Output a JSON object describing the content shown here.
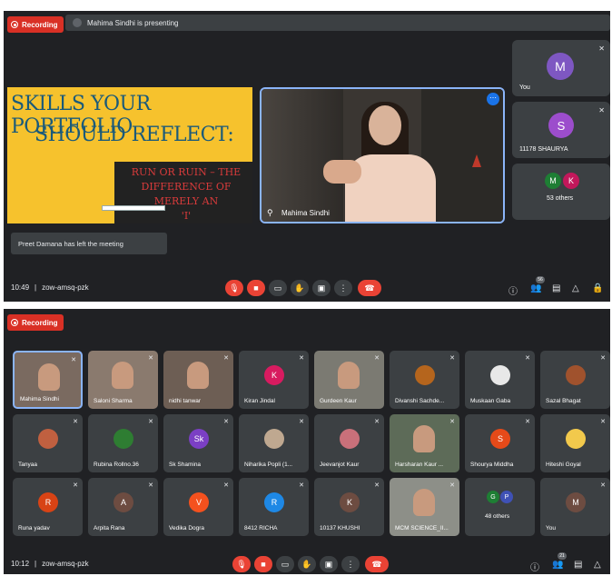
{
  "panel1": {
    "recording_label": "Recording",
    "presenting_text": "Mahima Sindhi is presenting",
    "slide": {
      "title_line1": "SKILLS YOUR PORTFOLIO",
      "title_line2": "SHOULD REFLECT:",
      "sub_line1": "RUN OR RUIN – THE",
      "sub_line2": "DIFFERENCE OF MERELY AN",
      "sub_line3": "'I'"
    },
    "presenter_name": "Mahima Sindhi",
    "side_tiles": [
      {
        "name": "You",
        "avatar_letter": "M",
        "avatar_color": "#7e57c2"
      },
      {
        "name": "11178 SHAURYA",
        "avatar_letter": "S",
        "avatar_color": "#9c4dcc"
      },
      {
        "name": "53 others",
        "avatar_letters": [
          "M",
          "K"
        ],
        "avatar_colors": [
          "#1e7e34",
          "#c2185b"
        ]
      }
    ],
    "toast": "Preet Damana has left the meeting",
    "time": "10:49",
    "meeting_code": "zow-amsq-pzk",
    "participant_count": "56"
  },
  "panel2": {
    "recording_label": "Recording",
    "time": "10:12",
    "meeting_code": "zow-amsq-pzk",
    "participant_count": "21",
    "tiles": [
      {
        "name": "Mahima Sindhi",
        "type": "video",
        "bg": "#7a6a60",
        "active": true
      },
      {
        "name": "Saloni Sharma",
        "type": "video",
        "bg": "#8a7a6e"
      },
      {
        "name": "nidhi tanwar",
        "type": "video",
        "bg": "#6d5e54"
      },
      {
        "name": "Kiran Jindal",
        "type": "avatar",
        "letter": "K",
        "color": "#d81b60"
      },
      {
        "name": "Gurdeen Kaur",
        "type": "video",
        "bg": "#7b7a72"
      },
      {
        "name": "Divanshi Sachde...",
        "type": "photo",
        "color": "#b5651d"
      },
      {
        "name": "Muskaan Gaba",
        "type": "photo",
        "color": "#e8e8e8"
      },
      {
        "name": "Sazal Bhagat",
        "type": "photo",
        "color": "#a0522d"
      },
      {
        "name": "Tanyaa",
        "type": "photo",
        "color": "#c06040"
      },
      {
        "name": "Rubina Rollno.36",
        "type": "photo",
        "color": "#2e7d32"
      },
      {
        "name": "Sk Shamina",
        "type": "avatar",
        "letter": "Sk",
        "color": "#7b3fc4"
      },
      {
        "name": "Niharika Popli (1...",
        "type": "photo",
        "color": "#bfa890"
      },
      {
        "name": "Jeevanjot Kaur",
        "type": "photo",
        "color": "#c9707a"
      },
      {
        "name": "Harsharan Kaur ...",
        "type": "video",
        "bg": "#5d6b58"
      },
      {
        "name": "Shourya Middha",
        "type": "avatar",
        "letter": "S",
        "color": "#e64a19"
      },
      {
        "name": "Hiteshi Goyal",
        "type": "photo",
        "color": "#f2c94c"
      },
      {
        "name": "Runa yadav",
        "type": "avatar",
        "letter": "R",
        "color": "#d84315"
      },
      {
        "name": "Arpita Rana",
        "type": "avatar",
        "letter": "A",
        "color": "#6d4c41"
      },
      {
        "name": "Vedika Dogra",
        "type": "avatar",
        "letter": "V",
        "color": "#f4511e"
      },
      {
        "name": "8412 RICHA",
        "type": "avatar",
        "letter": "R",
        "color": "#1e88e5"
      },
      {
        "name": "10137 KHUSHI",
        "type": "avatar",
        "letter": "K",
        "color": "#6d4c41"
      },
      {
        "name": "MCM SCIENCE_II...",
        "type": "video",
        "bg": "#8d8f88"
      },
      {
        "name": "48 others",
        "type": "group",
        "letters": [
          "G",
          "P"
        ],
        "colors": [
          "#1e7e34",
          "#3f51b5"
        ]
      },
      {
        "name": "You",
        "type": "avatar",
        "letter": "M",
        "color": "#6d4c41"
      }
    ]
  },
  "colors": {
    "background": "#202124",
    "tile": "#3c4043",
    "red": "#ea4335",
    "accent_blue": "#8ab4f8"
  },
  "icons": {
    "mic_off": "mic-off-icon",
    "cam_off": "camera-off-icon",
    "captions": "captions-icon",
    "raise_hand": "raise-hand-icon",
    "present": "present-icon",
    "more": "more-options-icon",
    "end_call": "end-call-icon",
    "info": "info-icon",
    "people": "people-icon",
    "chat": "chat-icon",
    "activities": "activities-icon",
    "lock": "host-controls-icon"
  }
}
